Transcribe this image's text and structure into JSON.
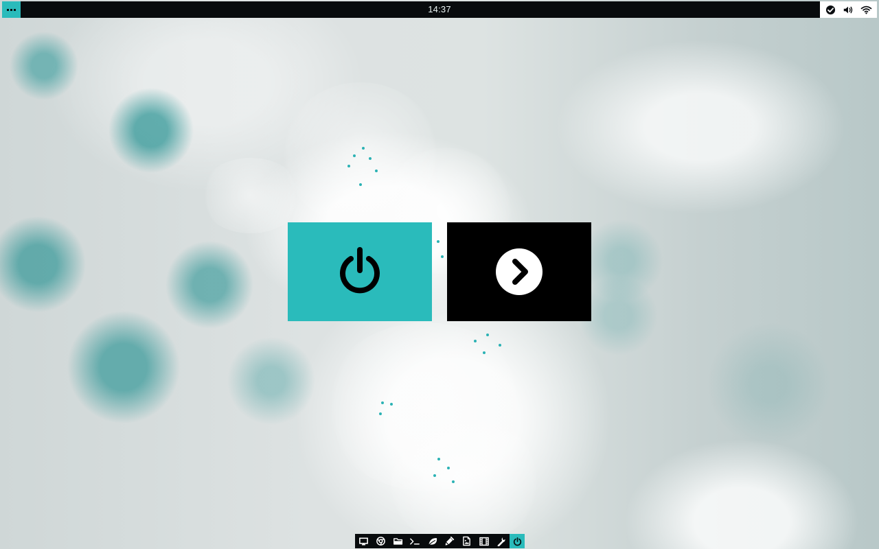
{
  "top_bar": {
    "clock": "14:37",
    "menu_icon": "more-icon",
    "status_icons": [
      "check-circle-icon",
      "volume-icon",
      "wifi-icon"
    ]
  },
  "center_actions": [
    {
      "name": "power",
      "icon": "power-icon",
      "background": "#2abbbb",
      "foreground": "#000000"
    },
    {
      "name": "continue",
      "icon": "chevron-right-circle-icon",
      "background": "#000000",
      "foreground": "#ffffff"
    }
  ],
  "dock": {
    "items": [
      "desktop-icon",
      "chrome-icon",
      "folder-icon",
      "terminal-icon",
      "leaf-icon",
      "brush-icon",
      "image-icon",
      "film-icon",
      "wrench-icon",
      "power-icon"
    ],
    "active_item": "power-icon"
  },
  "theme": {
    "accent": "#2abbbb",
    "bar": "#080b0d",
    "tray": "#ffffff"
  }
}
